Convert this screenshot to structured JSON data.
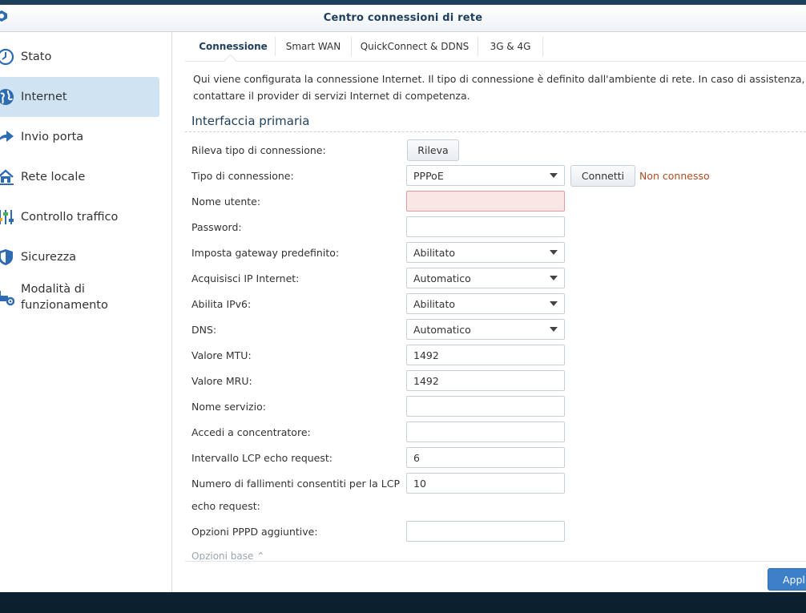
{
  "window": {
    "title": "Centro connessioni di rete"
  },
  "sidebar": {
    "items": [
      {
        "label": "Stato",
        "icon": "clock-icon"
      },
      {
        "label": "Internet",
        "icon": "globe-icon",
        "active": true
      },
      {
        "label": "Invio porta",
        "icon": "arrow-right-icon"
      },
      {
        "label": "Rete locale",
        "icon": "home-network-icon"
      },
      {
        "label": "Controllo traffico",
        "icon": "sliders-icon"
      },
      {
        "label": "Sicurezza",
        "icon": "shield-icon"
      },
      {
        "label": "Modalità di funzionamento",
        "icon": "router-gear-icon"
      }
    ]
  },
  "tabs": [
    {
      "label": "Connessione",
      "active": true
    },
    {
      "label": "Smart WAN"
    },
    {
      "label": "QuickConnect & DDNS"
    },
    {
      "label": "3G & 4G"
    }
  ],
  "description": "Qui viene configurata la connessione Internet. Il tipo di connessione è definito dall'ambiente di rete. In caso di assistenza, contattare il provider di servizi Internet di competenza.",
  "section": {
    "title": "Interfaccia primaria"
  },
  "form": {
    "detect": {
      "label": "Rileva tipo di connessione:",
      "button": "Rileva"
    },
    "connection_type": {
      "label": "Tipo di connessione:",
      "value": "PPPoE",
      "button": "Connetti",
      "status": "Non connesso"
    },
    "username": {
      "label": "Nome utente:",
      "value": ""
    },
    "password": {
      "label": "Password:",
      "value": ""
    },
    "default_gateway": {
      "label": "Imposta gateway predefinito:",
      "value": "Abilitato"
    },
    "get_ip": {
      "label": "Acquisisci IP Internet:",
      "value": "Automatico"
    },
    "ipv6": {
      "label": "Abilita IPv6:",
      "value": "Abilitato"
    },
    "dns": {
      "label": "DNS:",
      "value": "Automatico"
    },
    "mtu": {
      "label": "Valore MTU:",
      "value": "1492"
    },
    "mru": {
      "label": "Valore MRU:",
      "value": "1492"
    },
    "service_name": {
      "label": "Nome servizio:",
      "value": ""
    },
    "concentrator": {
      "label": "Accedi a concentratore:",
      "value": ""
    },
    "lcp_interval": {
      "label": "Intervallo LCP echo request:",
      "value": "6"
    },
    "lcp_failures": {
      "label_line1": "Numero di fallimenti consentiti per la LCP",
      "label_line2": "echo request:",
      "value": "10"
    },
    "pppd_options": {
      "label": "Opzioni PPPD aggiuntive:",
      "value": ""
    }
  },
  "footer": {
    "options_link": "Opzioni base",
    "apply_button": "Applica"
  },
  "colors": {
    "accent": "#3d7fc8",
    "active_sidebar": "#cfe3f3",
    "error_field": "#fbe6e6",
    "status_warning": "#b24a1f",
    "title": "#1d3e5c"
  }
}
